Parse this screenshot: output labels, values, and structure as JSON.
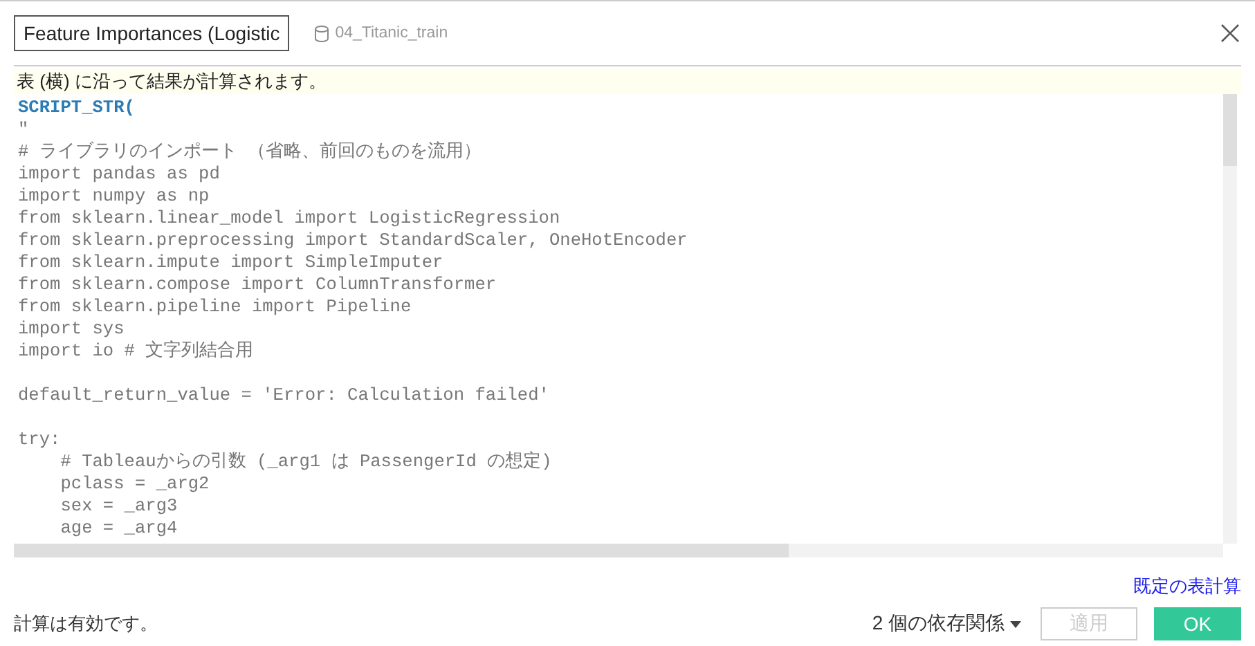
{
  "header": {
    "name_field": "Feature Importances (Logistic",
    "datasource": "04_Titanic_train"
  },
  "banner": "表 (横) に沿って結果が計算されます。",
  "code_lines": [
    {
      "kind": "function",
      "text": "SCRIPT_STR("
    },
    {
      "kind": "text",
      "text": "\""
    },
    {
      "kind": "text",
      "text": "# ライブラリのインポート （省略、前回のものを流用）"
    },
    {
      "kind": "text",
      "text": "import pandas as pd"
    },
    {
      "kind": "text",
      "text": "import numpy as np"
    },
    {
      "kind": "text",
      "text": "from sklearn.linear_model import LogisticRegression"
    },
    {
      "kind": "text",
      "text": "from sklearn.preprocessing import StandardScaler, OneHotEncoder"
    },
    {
      "kind": "text",
      "text": "from sklearn.impute import SimpleImputer"
    },
    {
      "kind": "text",
      "text": "from sklearn.compose import ColumnTransformer"
    },
    {
      "kind": "text",
      "text": "from sklearn.pipeline import Pipeline"
    },
    {
      "kind": "text",
      "text": "import sys"
    },
    {
      "kind": "text",
      "text": "import io # 文字列結合用"
    },
    {
      "kind": "blank"
    },
    {
      "kind": "text",
      "text": "default_return_value = 'Error: Calculation failed'"
    },
    {
      "kind": "blank"
    },
    {
      "kind": "text",
      "text": "try:"
    },
    {
      "kind": "text",
      "text": "    # Tableauからの引数 (_arg1 は PassengerId の想定)"
    },
    {
      "kind": "text",
      "text": "    pclass = _arg2"
    },
    {
      "kind": "text",
      "text": "    sex = _arg3"
    },
    {
      "kind": "text",
      "text": "    age = _arg4"
    }
  ],
  "default_table_calc_link": "既定の表計算",
  "footer": {
    "status": "計算は有効です。",
    "dependencies": "2 個の依存関係",
    "apply": {
      "label": "適用",
      "disabled": true
    },
    "ok": {
      "label": "OK",
      "disabled": false
    }
  }
}
